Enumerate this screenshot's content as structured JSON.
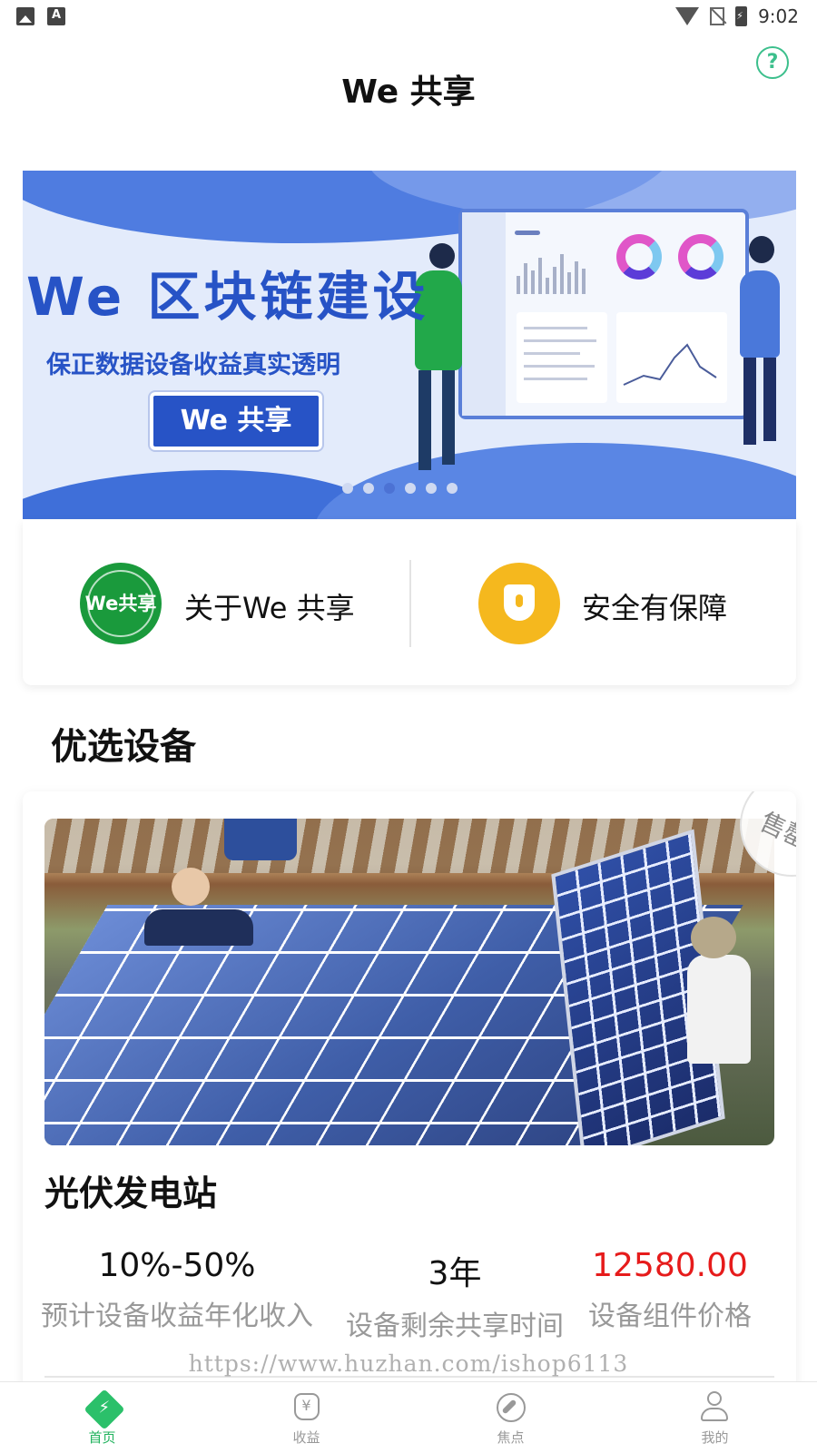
{
  "status_bar": {
    "time": "9:02"
  },
  "header": {
    "title": "We 共享"
  },
  "banner": {
    "headline": "We 区块链建设",
    "subtitle": "保正数据设备收益真实透明",
    "button_label": "We 共享",
    "dot_count": 6,
    "active_dot_index": 2
  },
  "info": {
    "about": {
      "icon_text": "We共享",
      "label": "关于We 共享"
    },
    "security": {
      "label": "安全有保障"
    }
  },
  "section": {
    "title": "优选设备"
  },
  "product": {
    "badge": "售罄",
    "name": "光伏发电站",
    "stats": [
      {
        "value": "10%-50%",
        "label": "预计设备收益年化收入"
      },
      {
        "value": "3年",
        "label": "设备剩余共享时间"
      },
      {
        "value": "12580.00",
        "label": "设备组件价格"
      }
    ]
  },
  "watermark": "https://www.huzhan.com/ishop6113",
  "tabbar": {
    "items": [
      {
        "label": "首页",
        "icon": "home-icon",
        "active": true
      },
      {
        "label": "收益",
        "icon": "money-bag-icon",
        "active": false
      },
      {
        "label": "焦点",
        "icon": "compass-icon",
        "active": false
      },
      {
        "label": "我的",
        "icon": "user-icon",
        "active": false
      }
    ]
  },
  "colors": {
    "accent": "#22b35e",
    "price": "#e61b1b",
    "banner_blue": "#2753c6"
  }
}
